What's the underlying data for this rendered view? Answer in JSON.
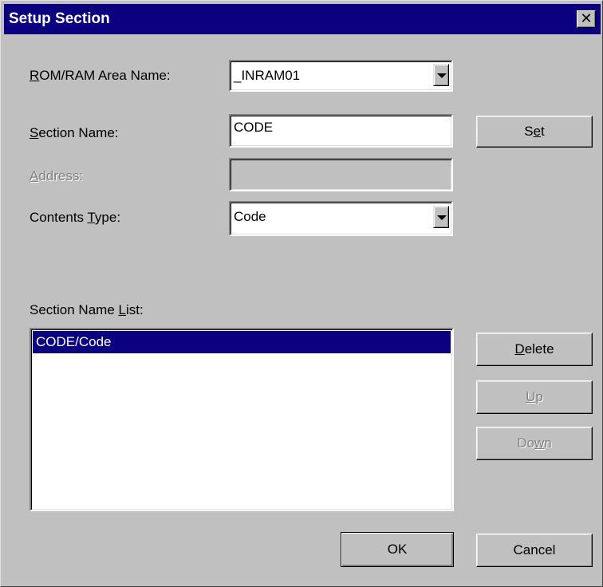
{
  "dialog": {
    "title": "Setup Section",
    "close_symbol": "✕"
  },
  "form": {
    "rom_ram_label_hotkey": "R",
    "rom_ram_label_rest": "OM/RAM Area Name:",
    "rom_ram_value": "_INRAM01",
    "section_label_hotkey": "S",
    "section_label_rest": "ection Name:",
    "section_value": "CODE",
    "address_label_hotkey": "A",
    "address_label_rest": "ddress:",
    "address_value": "",
    "contents_label_pre": "Contents ",
    "contents_label_hotkey": "T",
    "contents_label_rest": "ype:",
    "contents_value": "Code",
    "list_label_pre": "Section Name ",
    "list_label_hotkey": "L",
    "list_label_rest": "ist:"
  },
  "list": {
    "items": [
      "CODE/Code"
    ]
  },
  "buttons": {
    "set_pre": "S",
    "set_hotkey": "e",
    "set_rest": "t",
    "delete_hotkey": "D",
    "delete_rest": "elete",
    "up_hotkey": "U",
    "up_rest": "p",
    "down_pre": "Do",
    "down_hotkey": "w",
    "down_rest": "n",
    "ok": "OK",
    "cancel": "Cancel"
  },
  "colors": {
    "title_bar": "#0a0080",
    "face": "#c0c0c0",
    "selection": "#0a0080"
  }
}
